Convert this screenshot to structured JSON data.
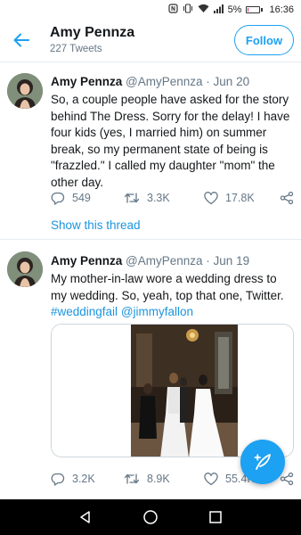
{
  "status_bar": {
    "battery_percent": "5%",
    "time": "16:36",
    "icons": [
      "nfc-icon",
      "vibrate-icon",
      "wifi-icon",
      "signal-icon",
      "battery-icon"
    ],
    "battery_level": 0.05,
    "battery_color": "#e0245e"
  },
  "header": {
    "name": "Amy Pennza",
    "tweet_count": "227 Tweets",
    "follow_label": "Follow",
    "accent_color": "#1da1f2"
  },
  "tweets": [
    {
      "name": "Amy Pennza",
      "handle": "@AmyPennza",
      "separator": " · ",
      "date": "Jun 20",
      "text": "So, a couple people have asked for the story behind The Dress. Sorry for the delay! I have four kids (yes, I married him) on summer break, so my permanent state of being is \"frazzled.\" I called my daughter \"mom\" the other day.",
      "replies": "549",
      "retweets": "3.3K",
      "likes": "17.8K",
      "show_thread": "Show this thread"
    },
    {
      "name": "Amy Pennza",
      "handle": "@AmyPennza",
      "separator": " · ",
      "date": "Jun 19",
      "text": "My mother-in-law wore a wedding dress to my wedding. So, yeah, top that one, Twitter. ",
      "hashtag": "#weddingfail",
      "mention": "@jimmyfallon",
      "replies": "3.2K",
      "retweets": "8.9K",
      "likes": "55.4K"
    }
  ],
  "nav": {
    "icons": [
      "back-triangle-icon",
      "home-circle-icon",
      "recents-square-icon"
    ]
  }
}
